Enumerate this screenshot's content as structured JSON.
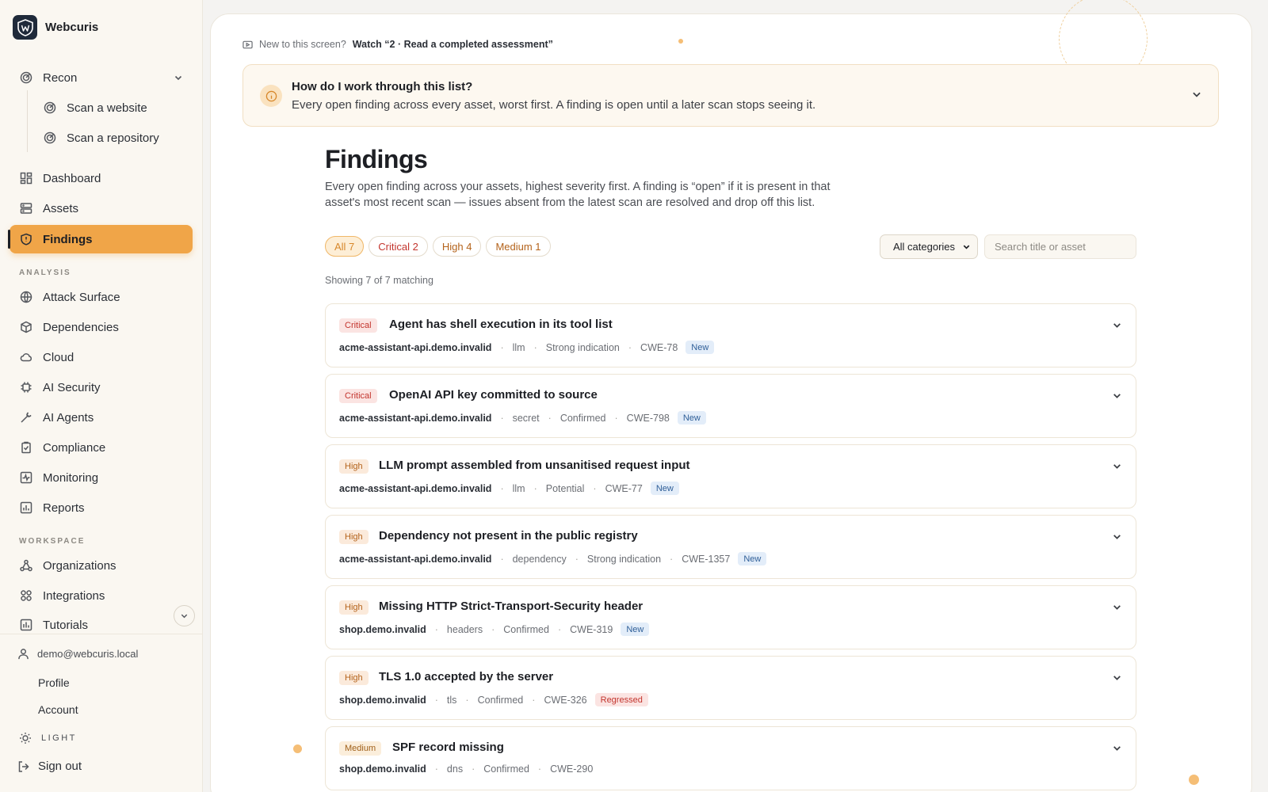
{
  "brand": {
    "name": "Webcuris"
  },
  "sidebar": {
    "recon": {
      "label": "Recon",
      "subitems": [
        "Scan a website",
        "Scan a repository"
      ]
    },
    "main_items": [
      {
        "label": "Dashboard",
        "icon": "dashboard-icon"
      },
      {
        "label": "Assets",
        "icon": "server-icon"
      },
      {
        "label": "Findings",
        "icon": "shield-icon",
        "active": true
      }
    ],
    "analysis_label": "ANALYSIS",
    "analysis_items": [
      {
        "label": "Attack Surface",
        "icon": "globe-icon"
      },
      {
        "label": "Dependencies",
        "icon": "package-icon"
      },
      {
        "label": "Cloud",
        "icon": "cloud-icon"
      },
      {
        "label": "AI Security",
        "icon": "chip-icon"
      },
      {
        "label": "AI Agents",
        "icon": "wrench-icon"
      },
      {
        "label": "Compliance",
        "icon": "clipboard-icon"
      },
      {
        "label": "Monitoring",
        "icon": "activity-icon"
      },
      {
        "label": "Reports",
        "icon": "bar-chart-icon"
      }
    ],
    "workspace_label": "WORKSPACE",
    "workspace_items": [
      {
        "label": "Organizations",
        "icon": "network-icon"
      },
      {
        "label": "Integrations",
        "icon": "puzzle-icon"
      },
      {
        "label": "Tutorials",
        "icon": "chart-box-icon"
      }
    ],
    "user_email": "demo@webcuris.local",
    "profile_label": "Profile",
    "account_label": "Account",
    "theme_label": "LIGHT",
    "signout_label": "Sign out"
  },
  "tip": {
    "prefix": "New to this screen?",
    "link": "Watch “2 · Read a completed assessment”"
  },
  "help": {
    "title": "How do I work through this list?",
    "description": "Every open finding across every asset, worst first. A finding is open until a later scan stops seeing it."
  },
  "page": {
    "title": "Findings",
    "description": "Every open finding across your assets, highest severity first. A finding is “open” if it is present in that asset's most recent scan — issues absent from the latest scan are resolved and drop off this list."
  },
  "filters": {
    "chips": [
      {
        "label": "All 7",
        "kind": "all"
      },
      {
        "label": "Critical 2",
        "kind": "critical"
      },
      {
        "label": "High 4",
        "kind": "high"
      },
      {
        "label": "Medium 1",
        "kind": "medium"
      }
    ],
    "category_value": "All categories",
    "search_placeholder": "Search title or asset"
  },
  "showing": "Showing 7 of 7 matching",
  "findings": [
    {
      "severity": "Critical",
      "title": "Agent has shell execution in its tool list",
      "asset": "acme-assistant-api.demo.invalid",
      "category": "llm",
      "confidence": "Strong indication",
      "cwe": "CWE-78",
      "tag": "New"
    },
    {
      "severity": "Critical",
      "title": "OpenAI API key committed to source",
      "asset": "acme-assistant-api.demo.invalid",
      "category": "secret",
      "confidence": "Confirmed",
      "cwe": "CWE-798",
      "tag": "New"
    },
    {
      "severity": "High",
      "title": "LLM prompt assembled from unsanitised request input",
      "asset": "acme-assistant-api.demo.invalid",
      "category": "llm",
      "confidence": "Potential",
      "cwe": "CWE-77",
      "tag": "New"
    },
    {
      "severity": "High",
      "title": "Dependency not present in the public registry",
      "asset": "acme-assistant-api.demo.invalid",
      "category": "dependency",
      "confidence": "Strong indication",
      "cwe": "CWE-1357",
      "tag": "New"
    },
    {
      "severity": "High",
      "title": "Missing HTTP Strict-Transport-Security header",
      "asset": "shop.demo.invalid",
      "category": "headers",
      "confidence": "Confirmed",
      "cwe": "CWE-319",
      "tag": "New"
    },
    {
      "severity": "High",
      "title": "TLS 1.0 accepted by the server",
      "asset": "shop.demo.invalid",
      "category": "tls",
      "confidence": "Confirmed",
      "cwe": "CWE-326",
      "tag": "Regressed"
    },
    {
      "severity": "Medium",
      "title": "SPF record missing",
      "asset": "shop.demo.invalid",
      "category": "dns",
      "confidence": "Confirmed",
      "cwe": "CWE-290",
      "tag": ""
    }
  ],
  "colors": {
    "accent": "#f0a548",
    "critical": "#c3352e",
    "high": "#b4631b",
    "new_tag": "#2f5f98"
  }
}
